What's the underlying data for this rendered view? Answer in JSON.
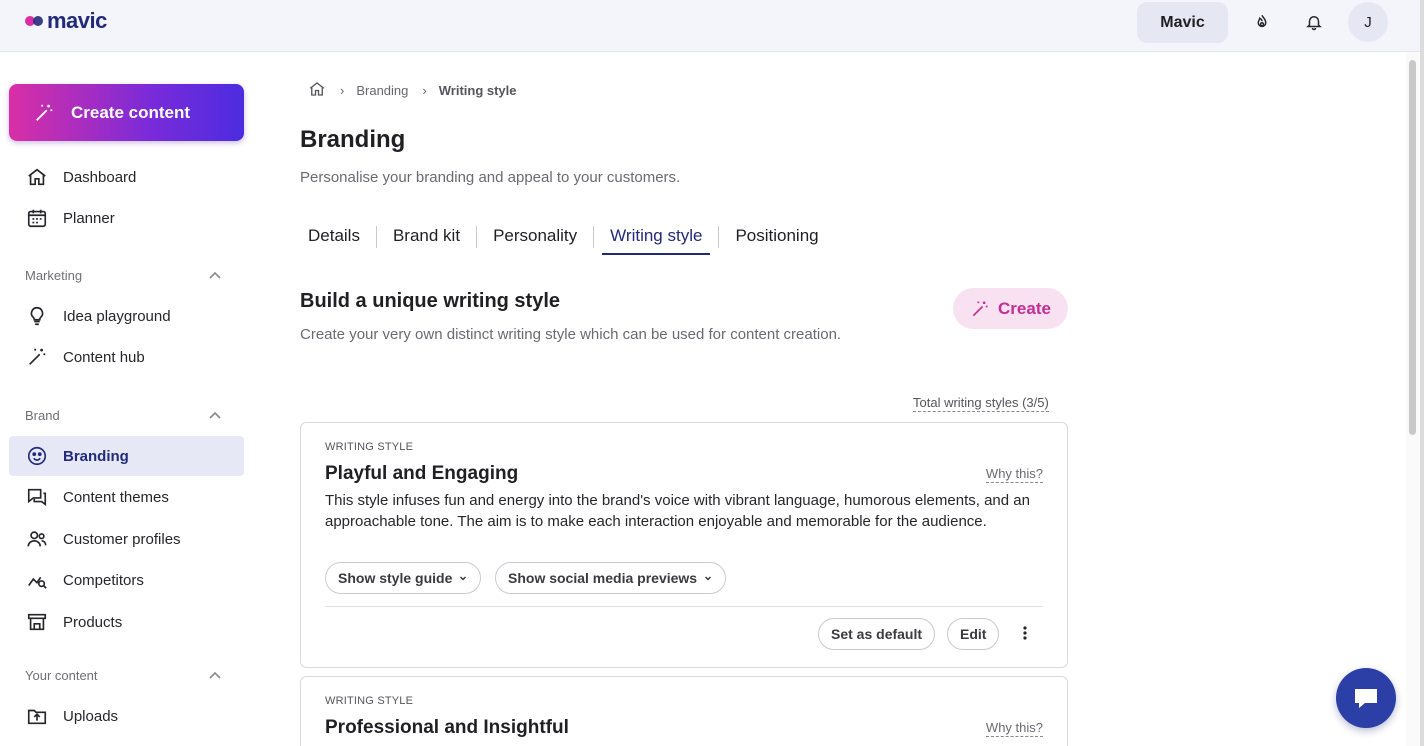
{
  "app": {
    "logo_text": "mavic"
  },
  "topbar": {
    "workspace": "Mavic",
    "avatar_initial": "J"
  },
  "sidebar": {
    "create_label": "Create content",
    "top_items": [
      {
        "label": "Dashboard",
        "icon": "home-icon"
      },
      {
        "label": "Planner",
        "icon": "calendar-icon"
      }
    ],
    "sections": [
      {
        "label": "Marketing",
        "items": [
          {
            "label": "Idea playground",
            "icon": "lightbulb-icon"
          },
          {
            "label": "Content hub",
            "icon": "magic-wand-icon"
          }
        ]
      },
      {
        "label": "Brand",
        "items": [
          {
            "label": "Branding",
            "icon": "palette-icon",
            "active": true
          },
          {
            "label": "Content themes",
            "icon": "chat-bubbles-icon"
          },
          {
            "label": "Customer profiles",
            "icon": "users-icon"
          },
          {
            "label": "Competitors",
            "icon": "chart-search-icon"
          },
          {
            "label": "Products",
            "icon": "store-icon"
          }
        ]
      },
      {
        "label": "Your content",
        "items": [
          {
            "label": "Uploads",
            "icon": "upload-folder-icon"
          }
        ]
      }
    ]
  },
  "breadcrumb": {
    "items": [
      "Branding",
      "Writing style"
    ]
  },
  "page": {
    "title": "Branding",
    "subtitle": "Personalise your branding and appeal to your customers."
  },
  "tabs": [
    {
      "label": "Details"
    },
    {
      "label": "Brand kit"
    },
    {
      "label": "Personality"
    },
    {
      "label": "Writing style",
      "active": true
    },
    {
      "label": "Positioning"
    }
  ],
  "section": {
    "title": "Build a unique writing style",
    "subtitle": "Create your very own distinct writing style which can be used for content creation.",
    "create_label": "Create",
    "total": "Total writing styles (3/5)"
  },
  "cards": [
    {
      "kicker": "WRITING STYLE",
      "title": "Playful and Engaging",
      "why": "Why this?",
      "description": "This style infuses fun and energy into the brand's voice with vibrant language, humorous elements, and an approachable tone. The aim is to make each interaction enjoyable and memorable for the audience.",
      "show_guide": "Show style guide",
      "show_previews": "Show social media previews",
      "set_default": "Set as default",
      "edit": "Edit"
    },
    {
      "kicker": "WRITING STYLE",
      "title": "Professional and Insightful",
      "why": "Why this?"
    }
  ],
  "colors": {
    "brand_navy": "#232a7a",
    "accent_pink": "#c22e93",
    "active_bg": "#e6e8f6"
  }
}
